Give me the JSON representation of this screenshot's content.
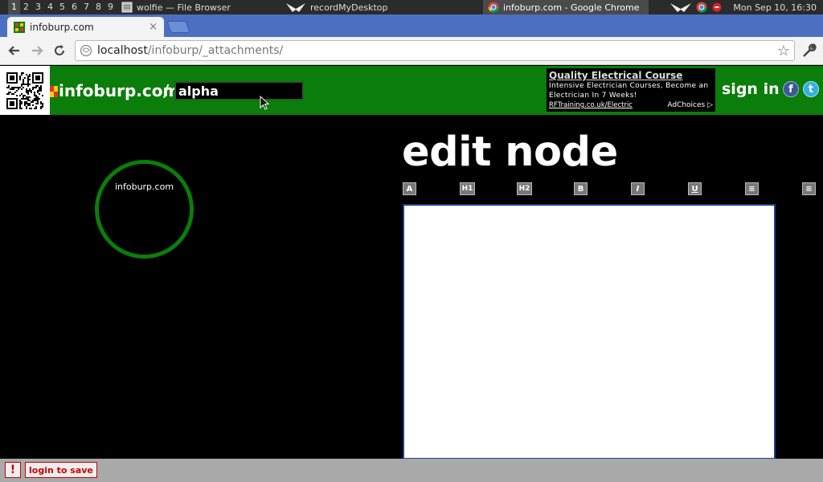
{
  "taskbar": {
    "workspaces": [
      "1",
      "2",
      "3",
      "4",
      "5",
      "6",
      "7",
      "8",
      "9"
    ],
    "tasks": [
      {
        "label": "wolfie — File Browser",
        "icon": "file-browser-icon"
      },
      {
        "label": "recordMyDesktop",
        "icon": "record-icon"
      },
      {
        "label": "infoburp.com - Google Chrome",
        "icon": "chrome-icon"
      }
    ],
    "clock": "Mon Sep 10, 16:30"
  },
  "browser": {
    "tab_title": "infoburp.com",
    "tab_close": "×",
    "url_host": "localhost",
    "url_path": "/infoburp/_attachments/"
  },
  "site": {
    "name": "infoburp.com",
    "separator": "/",
    "node_value": "alpha",
    "sign_in": "sign in :",
    "facebook_glyph": "f",
    "twitter_glyph": "t",
    "brand_color": "#0a7d0a"
  },
  "ad": {
    "title": "Quality Electrical Course",
    "body": "Intensive Electrician Courses, Become an Electrician In 7 Weeks!",
    "link": "RFTraining.co.uk/Electric",
    "choices": "AdChoices ▷"
  },
  "main": {
    "node_label": "infoburp.com",
    "edit_title": "edit node",
    "format_buttons": [
      {
        "label": "A",
        "name": "font-button"
      },
      {
        "label": "H1",
        "name": "heading1-button"
      },
      {
        "label": "H2",
        "name": "heading2-button"
      },
      {
        "label": "B",
        "name": "bold-button"
      },
      {
        "label": "I",
        "name": "italic-button"
      },
      {
        "label": "U",
        "name": "underline-button"
      },
      {
        "label": "≡",
        "name": "list-button"
      },
      {
        "label": "≡",
        "name": "list-alt-button"
      }
    ],
    "editor_value": ""
  },
  "status": {
    "warning_glyph": "!",
    "login_label": "login to save"
  }
}
